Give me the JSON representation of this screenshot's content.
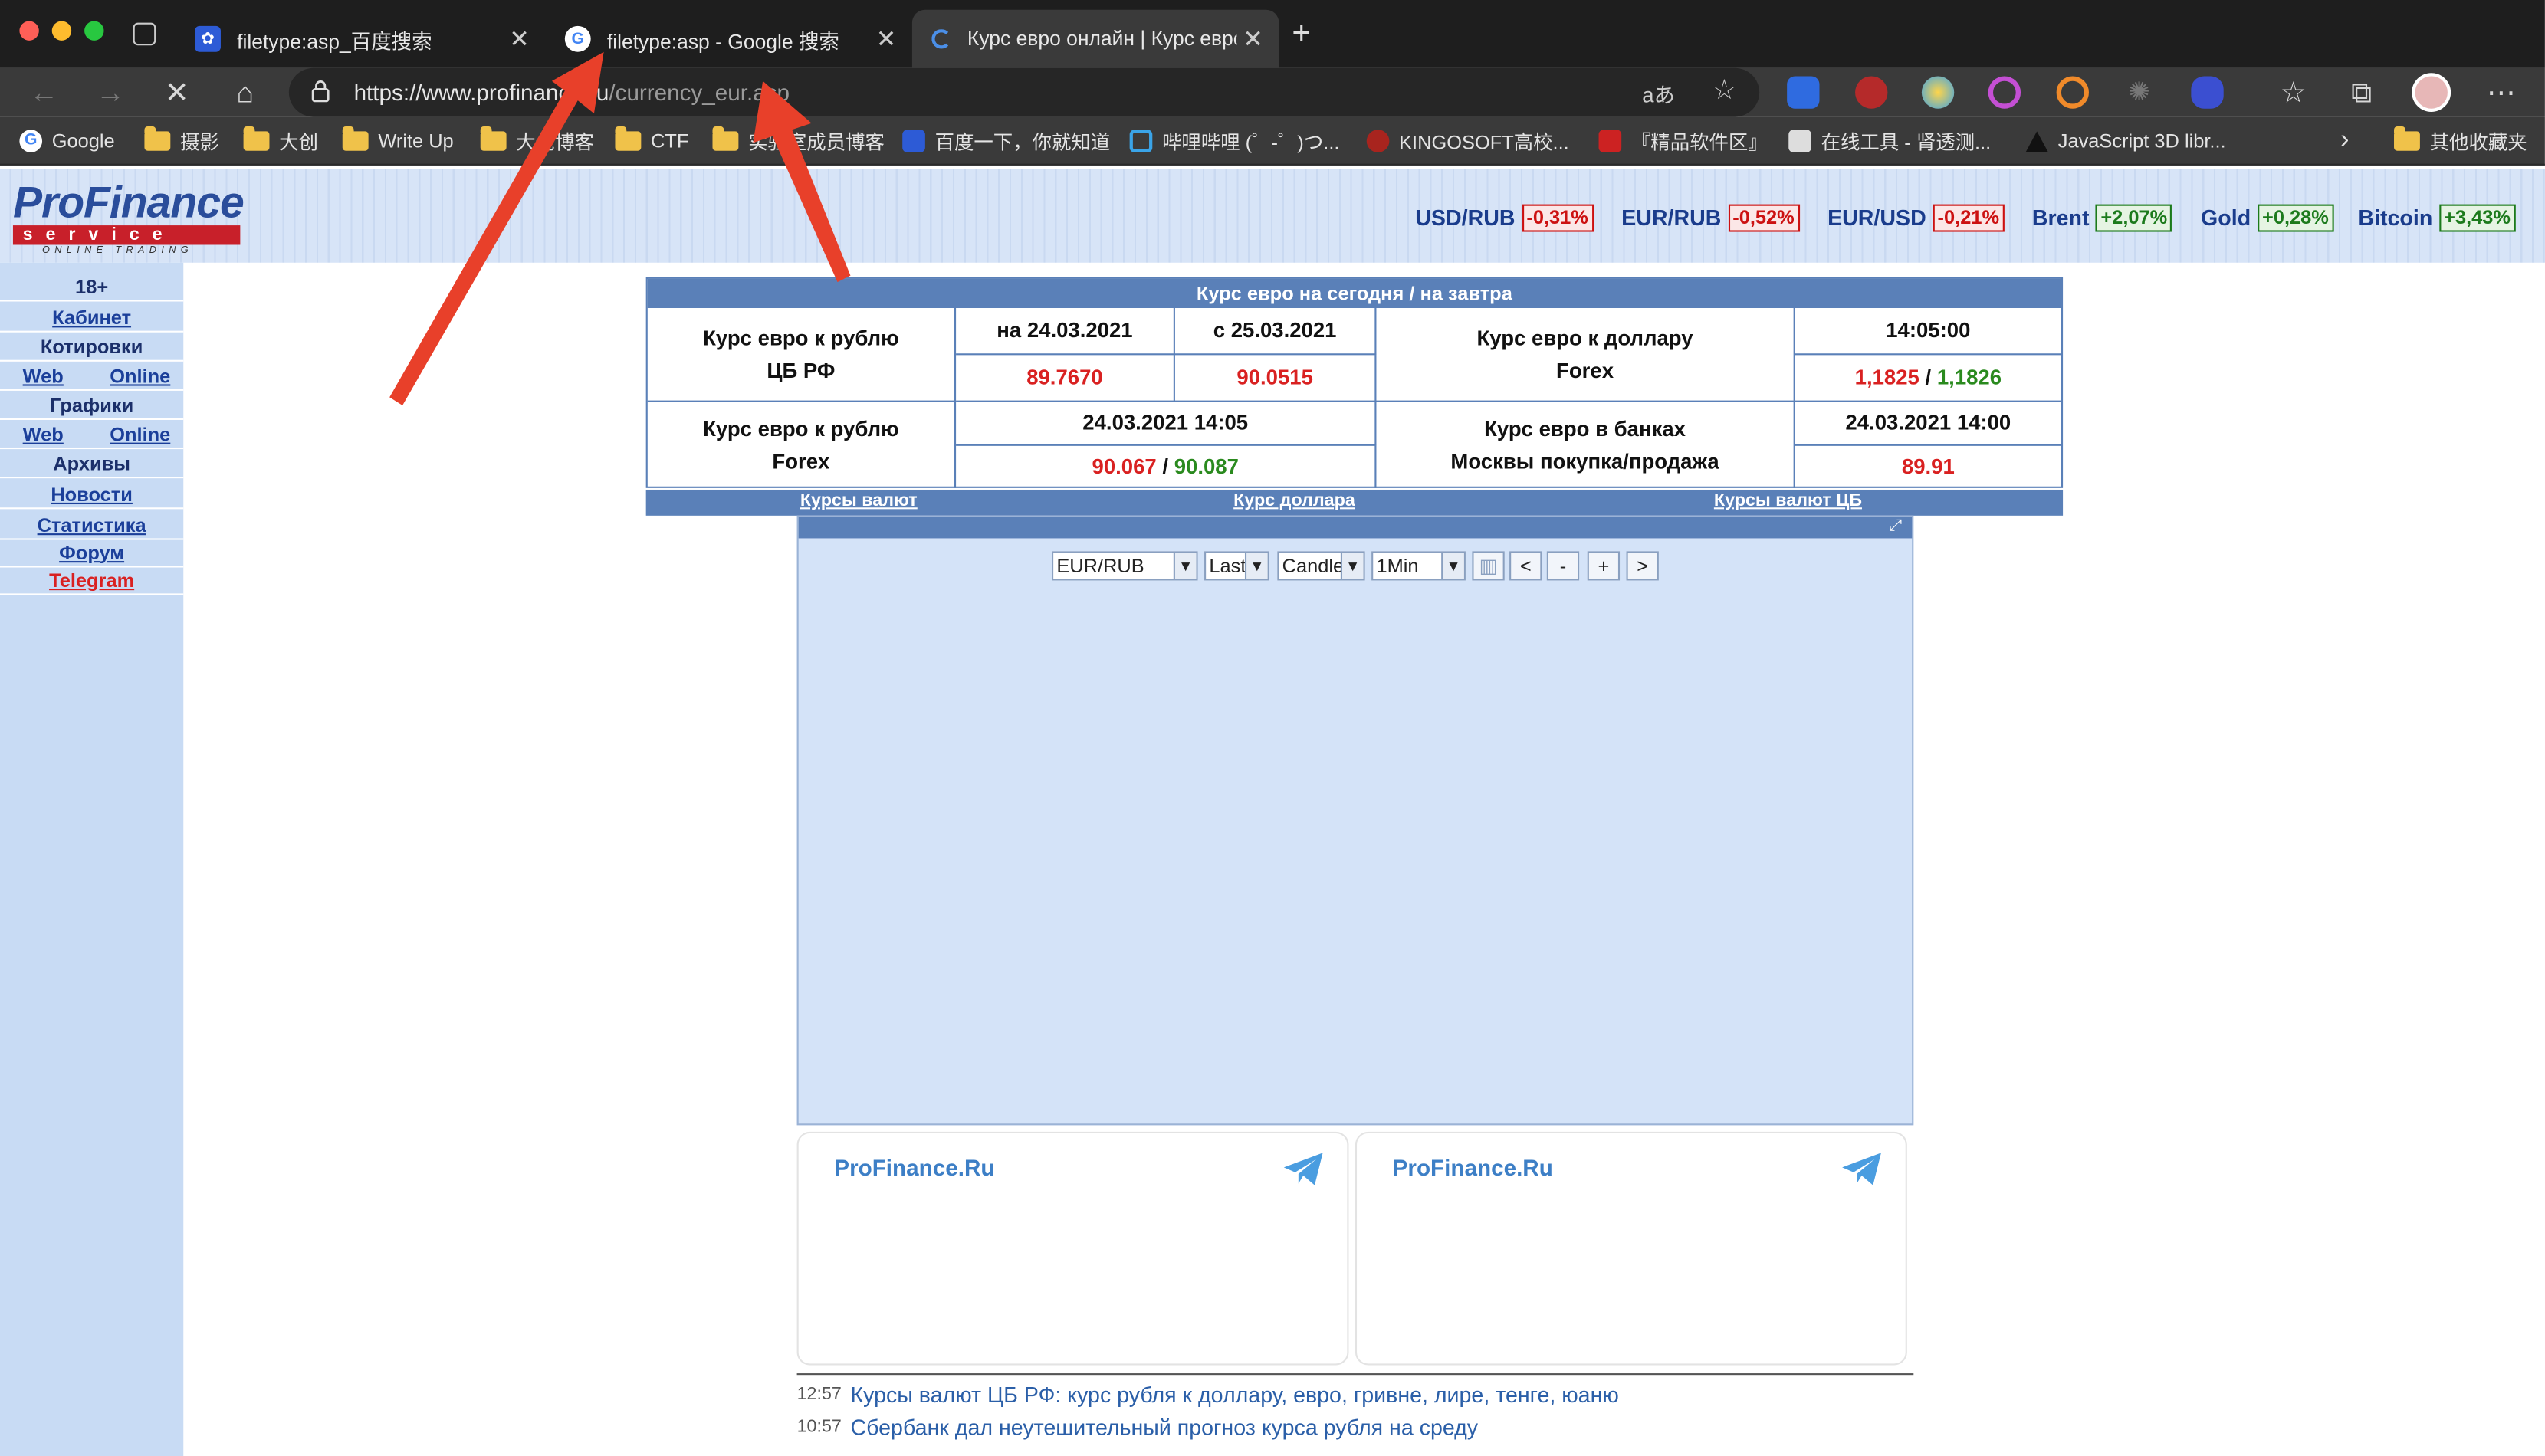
{
  "browser": {
    "tabs": [
      {
        "title": "filetype:asp_百度搜索",
        "icon": "baidu-icon"
      },
      {
        "title": "filetype:asp - Google 搜索",
        "icon": "google-icon"
      },
      {
        "title": "Курс евро онлайн | Курс евро",
        "icon": "loading-icon"
      }
    ],
    "url_main": "https://www.profinance.ru",
    "url_path": "/currency_eur.asp",
    "bookmarks": [
      "Google",
      "摄影",
      "大创",
      "Write Up",
      "大佬博客",
      "CTF",
      "实验室成员博客",
      "百度一下，你就知道",
      "哔哩哔哩 (゜-゜)つ...",
      "KINGOSOFT高校...",
      "『精品软件区』",
      "在线工具 - 肾透测...",
      "JavaScript 3D libr...",
      "其他收藏夹"
    ]
  },
  "site": {
    "logo": {
      "line1": "ProFinance",
      "line2": "service",
      "line3": "ONLINE TRADING"
    },
    "tickers": [
      {
        "name": "USD/RUB",
        "change": "-0,31%",
        "dir": "neg"
      },
      {
        "name": "EUR/RUB",
        "change": "-0,52%",
        "dir": "neg"
      },
      {
        "name": "EUR/USD",
        "change": "-0,21%",
        "dir": "neg"
      },
      {
        "name": "Brent",
        "change": "+2,07%",
        "dir": "pos"
      },
      {
        "name": "Gold",
        "change": "+0,28%",
        "dir": "pos"
      },
      {
        "name": "Bitcoin",
        "change": "+3,43%",
        "dir": "pos"
      }
    ],
    "sidebar": {
      "age": "18+",
      "cabinet": "Кабинет",
      "quotes": "Котировки",
      "web": "Web",
      "online": "Online",
      "charts": "Графики",
      "archives": "Архивы",
      "news": "Новости",
      "stats": "Статистика",
      "forum": "Форум",
      "telegram": "Telegram"
    },
    "rates_table": {
      "header": "Курс евро на сегодня / на завтра",
      "cbr_label_1": "Курс евро к рублю",
      "cbr_label_2": "ЦБ РФ",
      "date_today": "на 24.03.2021",
      "date_tomorrow": "с 25.03.2021",
      "cbr_today": "89.7670",
      "cbr_tomorrow": "90.0515",
      "eurusd_label_1": "Курс евро к доллару",
      "eurusd_label_2": "Forex",
      "eurusd_time": "14:05:00",
      "eurusd_bid": "1,1825",
      "eurusd_sep": "/",
      "eurusd_ask": "1,1826",
      "forex_label_1": "Курс евро к рублю",
      "forex_label_2": "Forex",
      "forex_time": "24.03.2021 14:05",
      "forex_bid": "90.067",
      "forex_sep": "/",
      "forex_ask": "90.087",
      "banks_label_1": "Курс евро в банках",
      "banks_label_2": "Москвы покупка/продажа",
      "banks_time": "24.03.2021 14:00",
      "banks_value": "89.91"
    },
    "links": [
      "Курсы валют",
      "Курс доллара",
      "Курсы валют ЦБ"
    ],
    "chart_controls": {
      "symbol": "EUR/RUB",
      "price": "Last",
      "type": "Candle",
      "interval": "1Min",
      "buttons": [
        "<",
        "-",
        "+",
        ">"
      ]
    },
    "cards": [
      {
        "name": "ProFinance.Ru"
      },
      {
        "name": "ProFinance.Ru"
      }
    ],
    "news": [
      {
        "time": "12:57",
        "text": "Курсы валют ЦБ РФ: курс рубля к доллару, евро, гривне, лире, тенге, юаню"
      },
      {
        "time": "10:57",
        "text": "Сбербанк дал неутешительный прогноз курса рубля на среду"
      }
    ]
  },
  "colors": {
    "accent_blue": "#5a80b8",
    "red": "#d92121",
    "green": "#2a8a1e",
    "arrow": "#e8402a"
  }
}
